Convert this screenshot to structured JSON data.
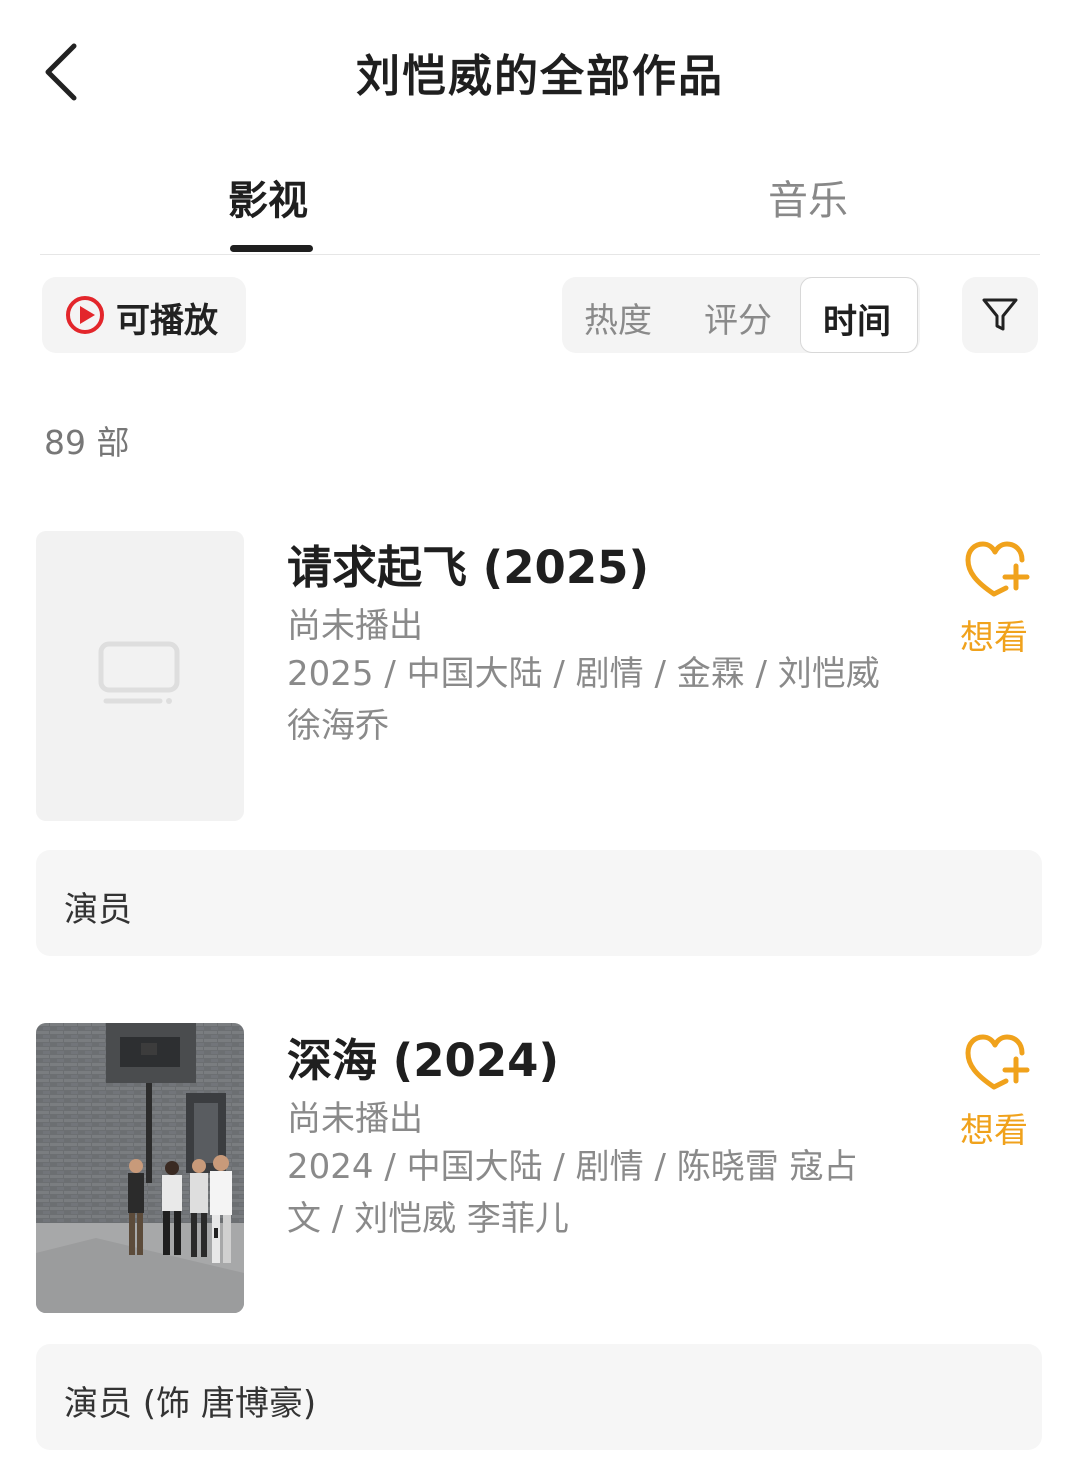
{
  "header": {
    "title": "刘恺威的全部作品"
  },
  "tabs": [
    {
      "label": "影视",
      "active": true
    },
    {
      "label": "音乐",
      "active": false
    }
  ],
  "filters": {
    "playable_label": "可播放",
    "sort_options": [
      {
        "label": "热度",
        "selected": false
      },
      {
        "label": "评分",
        "selected": false
      },
      {
        "label": "时间",
        "selected": true
      }
    ]
  },
  "count_text": "89 部",
  "works": [
    {
      "title": "请求起飞 (2025)",
      "status": "尚未播出",
      "meta": "2025 / 中国大陆 / 剧情 / 金霖 / 刘恺威 徐海乔",
      "want_label": "想看",
      "role": "演员",
      "poster": "placeholder-tv-icon"
    },
    {
      "title": "深海 (2024)",
      "status": "尚未播出",
      "meta": "2024 / 中国大陆 / 剧情 / 陈晓雷 寇占文 / 刘恺威 李菲儿",
      "want_label": "想看",
      "role": "演员 (饰 唐博豪)",
      "poster": "street-photo"
    }
  ],
  "colors": {
    "accent_orange": "#f0a21c",
    "play_red": "#e3262b",
    "text_dark": "#1f1f1f",
    "text_gray": "#8a8a8a"
  }
}
